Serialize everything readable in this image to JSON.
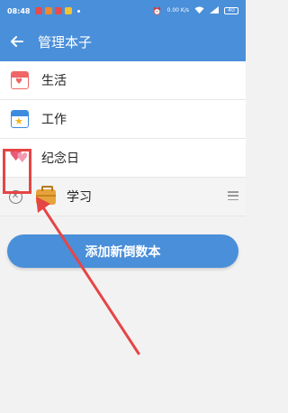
{
  "status_bar": {
    "time": "08:48",
    "network_speed": "0.00 K/s",
    "battery": "40"
  },
  "app_bar": {
    "back_icon": "arrow-left-icon",
    "title": "管理本子"
  },
  "notebooks": [
    {
      "label": "生活",
      "icon": "calendar-heart-icon"
    },
    {
      "label": "工作",
      "icon": "calendar-star-icon"
    },
    {
      "label": "纪念日",
      "icon": "hearts-icon"
    },
    {
      "label": "学习",
      "icon": "briefcase-icon",
      "editing": true
    }
  ],
  "add_button": {
    "label": "添加新倒数本"
  },
  "colors": {
    "accent": "#4a8fd9",
    "annotation": "#e64545"
  }
}
